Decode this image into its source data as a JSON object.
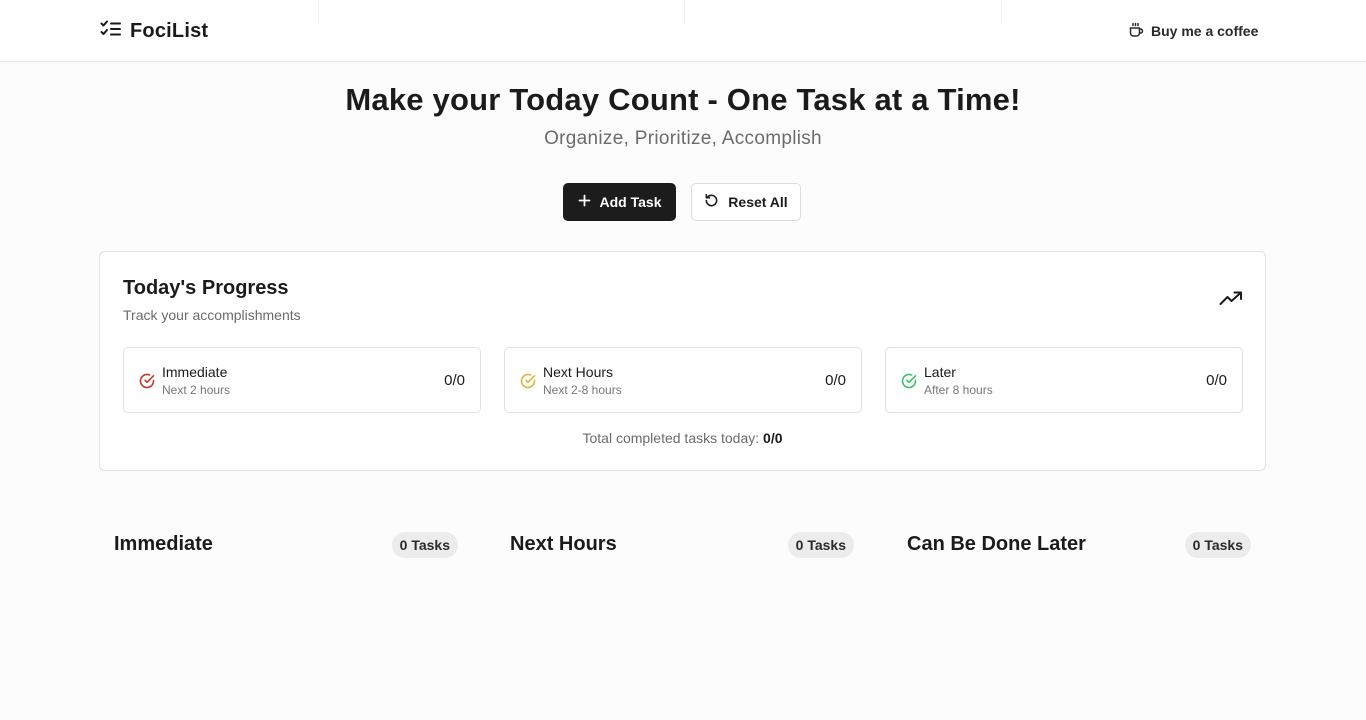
{
  "brand": {
    "name": "FociList",
    "icon": "list-checks-icon"
  },
  "header": {
    "coffee_label": "Buy me a coffee",
    "coffee_icon": "coffee-icon"
  },
  "hero": {
    "title": "Make your Today Count - One Task at a Time!",
    "subtitle": "Organize, Prioritize, Accomplish"
  },
  "actions": {
    "add_label": "Add Task",
    "reset_label": "Reset All"
  },
  "progress": {
    "title": "Today's Progress",
    "subtitle": "Track your accomplishments",
    "stats": [
      {
        "name": "Immediate",
        "desc": "Next 2 hours",
        "count": "0/0",
        "color": "#c0392b"
      },
      {
        "name": "Next Hours",
        "desc": "Next 2-8 hours",
        "count": "0/0",
        "color": "#e0b43a"
      },
      {
        "name": "Later",
        "desc": "After 8 hours",
        "count": "0/0",
        "color": "#3ebd6a"
      }
    ],
    "total_label": "Total completed tasks today: ",
    "total_value": "0/0"
  },
  "columns": [
    {
      "title": "Immediate",
      "badge": "0 Tasks"
    },
    {
      "title": "Next Hours",
      "badge": "0 Tasks"
    },
    {
      "title": "Can Be Done Later",
      "badge": "0 Tasks"
    }
  ],
  "colors": {
    "accent_dark": "#1c1c1c",
    "border": "#e2e2e2",
    "muted_text": "#6b6b6b"
  }
}
